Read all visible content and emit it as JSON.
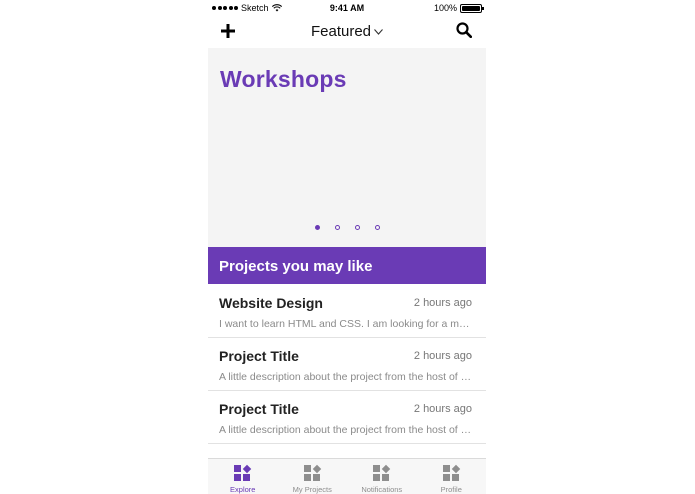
{
  "status_bar": {
    "carrier": "Sketch",
    "time": "9:41 AM",
    "battery": "100%"
  },
  "nav": {
    "title": "Featured",
    "add_icon": "plus-icon",
    "search_icon": "search-icon",
    "dropdown_icon": "chevron-down-icon"
  },
  "hero": {
    "title": "Workshops",
    "page_count": 4,
    "active_page": 1
  },
  "section": {
    "title": "Projects you may like"
  },
  "projects": [
    {
      "title": "Website Design",
      "time": "2 hours ago",
      "description": "I want to learn HTML and CSS. I am looking for a mentor to help me"
    },
    {
      "title": "Project Title",
      "time": "2 hours ago",
      "description": "A little description about the project from the host of the project"
    },
    {
      "title": "Project Title",
      "time": "2 hours ago",
      "description": "A little description about the project from the host of the project"
    }
  ],
  "tabs": [
    {
      "label": "Explore",
      "icon": "explore-icon",
      "active": true
    },
    {
      "label": "My Projects",
      "icon": "projects-icon",
      "active": false
    },
    {
      "label": "Notifications",
      "icon": "notifications-icon",
      "active": false
    },
    {
      "label": "Profile",
      "icon": "profile-icon",
      "active": false
    }
  ],
  "colors": {
    "accent": "#6a3bb5",
    "hero_bg": "#f4f4f4",
    "inactive": "#8e8e8e"
  }
}
